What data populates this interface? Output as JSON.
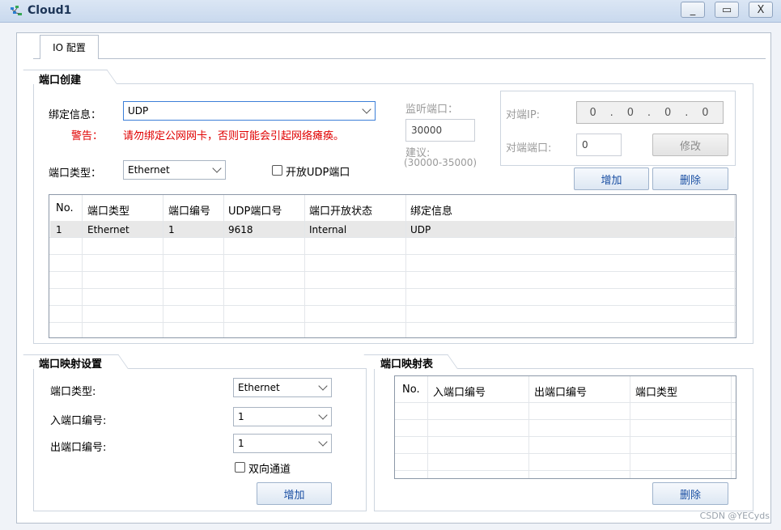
{
  "window": {
    "title": "Cloud1",
    "minimize": "_",
    "maximize": "▭",
    "close": "X"
  },
  "tabs": [
    {
      "label": "IO 配置",
      "active": true
    }
  ],
  "port_creation": {
    "section_title": "端口创建",
    "bind_label": "绑定信息：",
    "bind_value": "UDP",
    "warning_label": "警告：",
    "warning_text": "请勿绑定公网网卡，否则可能会引起网络瘫痪。",
    "port_type_label": "端口类型：",
    "port_type_value": "Ethernet",
    "open_udp_label": "开放UDP端口",
    "open_udp_checked": false,
    "listen_port_label": "监听端口：",
    "listen_port_value": "30000",
    "suggest_label": "建议:",
    "suggest_range": "(30000-35000)",
    "peer_ip_label": "对端IP:",
    "peer_ip_value": [
      "0",
      ".",
      "0",
      ".",
      "0",
      ".",
      "0"
    ],
    "peer_port_label": "对端端口:",
    "peer_port_value": "0",
    "modify_button": "修改",
    "add_button": "增加",
    "delete_button": "删除"
  },
  "port_table": {
    "columns": [
      "No.",
      "端口类型",
      "端口编号",
      "UDP端口号",
      "端口开放状态",
      "绑定信息"
    ],
    "rows": [
      [
        "1",
        "Ethernet",
        "1",
        "9618",
        "Internal",
        "UDP"
      ]
    ]
  },
  "mapping_settings": {
    "section_title": "端口映射设置",
    "port_type_label": "端口类型:",
    "port_type_value": "Ethernet",
    "in_port_label": "入端口编号:",
    "in_port_value": "1",
    "out_port_label": "出端口编号:",
    "out_port_value": "1",
    "bidirectional_label": "双向通道",
    "bidirectional_checked": false,
    "add_button": "增加"
  },
  "mapping_table": {
    "section_title": "端口映射表",
    "columns": [
      "No.",
      "入端口编号",
      "出端口编号",
      "端口类型"
    ],
    "delete_button": "删除"
  },
  "watermark": "CSDN @YECyds",
  "colors": {
    "warning": "#e00000",
    "button_text": "#1a4fa3",
    "selected_row": "#e8e8e8"
  }
}
